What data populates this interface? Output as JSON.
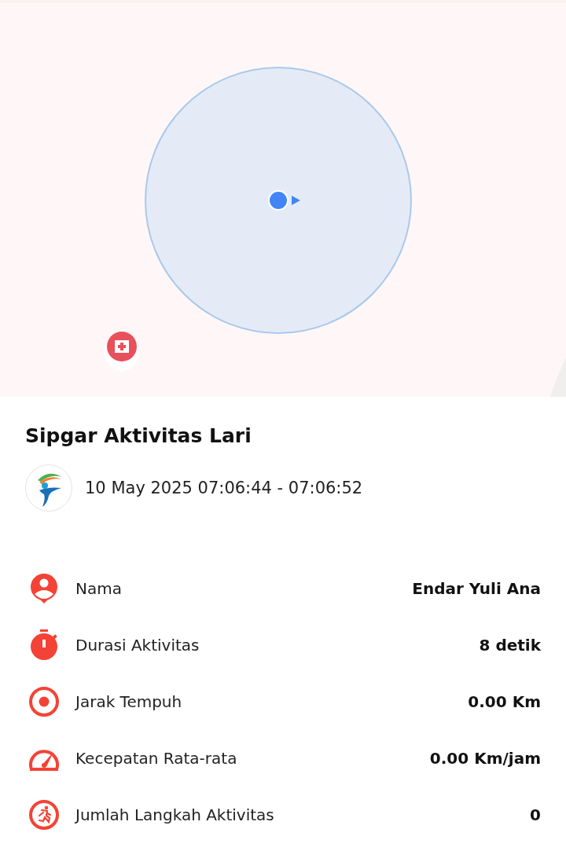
{
  "activity": {
    "title": "Sipgar Aktivitas Lari",
    "time_range": "10 May 2025 07:06:44 - 07:06:52"
  },
  "stats": [
    {
      "label": "Nama",
      "value": "Endar Yuli Ana"
    },
    {
      "label": "Durasi Aktivitas",
      "value": "8 detik"
    },
    {
      "label": "Jarak Tempuh",
      "value": "0.00 Km"
    },
    {
      "label": "Kecepatan Rata-rata",
      "value": "0.00 Km/jam"
    },
    {
      "label": "Jumlah Langkah Aktivitas",
      "value": "0"
    }
  ]
}
